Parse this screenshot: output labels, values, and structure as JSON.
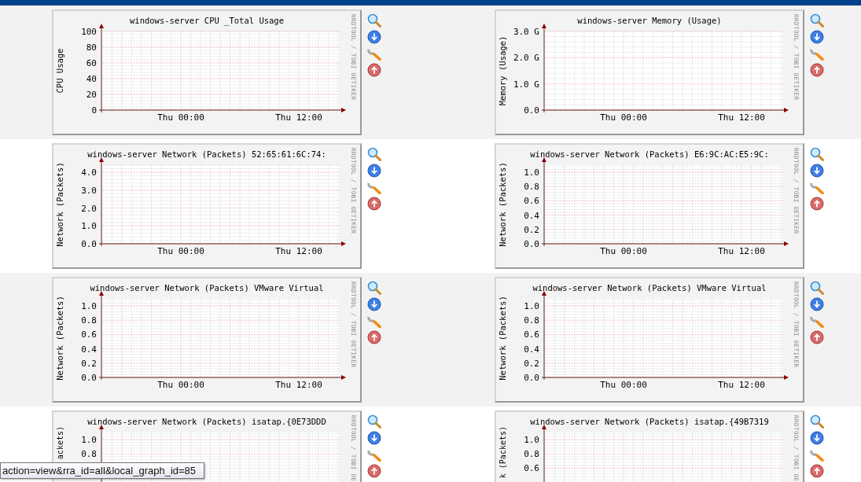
{
  "rows": [
    {
      "graphs": [
        {
          "title": "windows-server CPU _Total Usage",
          "credit": "RRDTOOL / TOBI OETIKER",
          "chart_data": {
            "type": "line",
            "grid": true,
            "ylabel": "CPU Usage",
            "categories": [
              null,
              null,
              null,
              null,
              null,
              null,
              null,
              null,
              "Thu 00:00",
              null,
              null,
              null,
              null,
              null,
              null,
              null,
              null,
              null,
              null,
              null,
              "Thu 12:00",
              null,
              null,
              null,
              null
            ],
            "ylim": [
              0,
              100
            ],
            "yticks": [
              {
                "value": 0,
                "label": "0"
              },
              {
                "value": 20,
                "label": "20"
              },
              {
                "value": 40,
                "label": "40"
              },
              {
                "value": 60,
                "label": "60"
              },
              {
                "value": 80,
                "label": "80"
              },
              {
                "value": 100,
                "label": "100"
              }
            ]
          }
        },
        {
          "title": "windows-server Memory (Usage)",
          "credit": "RRDTOOL / TOBI OETIKER",
          "chart_data": {
            "type": "line",
            "grid": true,
            "ylabel": "Memory (Usage)",
            "categories": [
              null,
              null,
              null,
              null,
              null,
              null,
              null,
              null,
              "Thu 00:00",
              null,
              null,
              null,
              null,
              null,
              null,
              null,
              null,
              null,
              null,
              null,
              "Thu 12:00",
              null,
              null,
              null,
              null
            ],
            "ylim": [
              0,
              3
            ],
            "yticks": [
              {
                "value": 0,
                "label": "0.0"
              },
              {
                "value": 1,
                "label": "1.0 G"
              },
              {
                "value": 2,
                "label": "2.0 G"
              },
              {
                "value": 3,
                "label": "3.0 G"
              }
            ]
          }
        }
      ]
    },
    {
      "graphs": [
        {
          "title": "windows-server Network (Packets) 52:65:61:6C:74:",
          "credit": "RRDTOOL / TOBI OETIKER",
          "chart_data": {
            "type": "line",
            "grid": true,
            "ylabel": "Network (Packets)",
            "categories": [
              null,
              null,
              null,
              null,
              null,
              null,
              null,
              null,
              "Thu 00:00",
              null,
              null,
              null,
              null,
              null,
              null,
              null,
              null,
              null,
              null,
              null,
              "Thu 12:00",
              null,
              null,
              null,
              null
            ],
            "ylim": [
              0,
              4.4
            ],
            "yticks": [
              {
                "value": 0,
                "label": "0.0"
              },
              {
                "value": 1,
                "label": "1.0"
              },
              {
                "value": 2,
                "label": "2.0"
              },
              {
                "value": 3,
                "label": "3.0"
              },
              {
                "value": 4,
                "label": "4.0"
              }
            ]
          }
        },
        {
          "title": "windows-server Network (Packets) E6:9C:AC:E5:9C:",
          "credit": "RRDTOOL / TOBI OETIKER",
          "chart_data": {
            "type": "line",
            "grid": true,
            "ylabel": "Network (Packets)",
            "categories": [
              null,
              null,
              null,
              null,
              null,
              null,
              null,
              null,
              "Thu 00:00",
              null,
              null,
              null,
              null,
              null,
              null,
              null,
              null,
              null,
              null,
              null,
              "Thu 12:00",
              null,
              null,
              null,
              null
            ],
            "ylim": [
              0,
              1.1
            ],
            "yticks": [
              {
                "value": 0,
                "label": "0.0"
              },
              {
                "value": 0.2,
                "label": "0.2"
              },
              {
                "value": 0.4,
                "label": "0.4"
              },
              {
                "value": 0.6,
                "label": "0.6"
              },
              {
                "value": 0.8,
                "label": "0.8"
              },
              {
                "value": 1,
                "label": "1.0"
              }
            ]
          }
        }
      ]
    },
    {
      "graphs": [
        {
          "title": "windows-server Network (Packets) VMware Virtual",
          "credit": "RRDTOOL / TOBI OETIKER",
          "chart_data": {
            "type": "line",
            "grid": true,
            "ylabel": "Network (Packets)",
            "categories": [
              null,
              null,
              null,
              null,
              null,
              null,
              null,
              null,
              "Thu 00:00",
              null,
              null,
              null,
              null,
              null,
              null,
              null,
              null,
              null,
              null,
              null,
              "Thu 12:00",
              null,
              null,
              null,
              null
            ],
            "ylim": [
              0,
              1.1
            ],
            "yticks": [
              {
                "value": 0,
                "label": "0.0"
              },
              {
                "value": 0.2,
                "label": "0.2"
              },
              {
                "value": 0.4,
                "label": "0.4"
              },
              {
                "value": 0.6,
                "label": "0.6"
              },
              {
                "value": 0.8,
                "label": "0.8"
              },
              {
                "value": 1,
                "label": "1.0"
              }
            ]
          }
        },
        {
          "title": "windows-server Network (Packets) VMware Virtual",
          "credit": "RRDTOOL / TOBI OETIKER",
          "chart_data": {
            "type": "line",
            "grid": true,
            "ylabel": "Network (Packets)",
            "categories": [
              null,
              null,
              null,
              null,
              null,
              null,
              null,
              null,
              "Thu 00:00",
              null,
              null,
              null,
              null,
              null,
              null,
              null,
              null,
              null,
              null,
              null,
              "Thu 12:00",
              null,
              null,
              null,
              null
            ],
            "ylim": [
              0,
              1.1
            ],
            "yticks": [
              {
                "value": 0,
                "label": "0.0"
              },
              {
                "value": 0.2,
                "label": "0.2"
              },
              {
                "value": 0.4,
                "label": "0.4"
              },
              {
                "value": 0.6,
                "label": "0.6"
              },
              {
                "value": 0.8,
                "label": "0.8"
              },
              {
                "value": 1,
                "label": "1.0"
              }
            ]
          }
        }
      ]
    },
    {
      "graphs": [
        {
          "title": "windows-server Network (Packets) isatap.{0E73DDD",
          "credit": "RRDTOOL / TOBI OE",
          "ylabel_clipped": true,
          "chart_data": {
            "type": "line",
            "grid": true,
            "ylabel": "ackets)",
            "categories": [
              null,
              null,
              null,
              null,
              null,
              null,
              null,
              null,
              null,
              null,
              null,
              null,
              null,
              null,
              null,
              null,
              null,
              null,
              null,
              null,
              null,
              null,
              null,
              null,
              null
            ],
            "ylim": [
              0,
              1.1
            ],
            "yticks": [
              {
                "value": 0.8,
                "label": "0.8"
              },
              {
                "value": 1,
                "label": "1.0"
              }
            ]
          }
        },
        {
          "title": "windows-server Network (Packets) isatap.{49B7319",
          "credit": "RRDTOOL / TOBI OE",
          "ylabel_clipped": true,
          "chart_data": {
            "type": "line",
            "grid": true,
            "ylabel": "k (Packets)",
            "categories": [
              null,
              null,
              null,
              null,
              null,
              null,
              null,
              null,
              null,
              null,
              null,
              null,
              null,
              null,
              null,
              null,
              null,
              null,
              null,
              null,
              null,
              null,
              null,
              null,
              null
            ],
            "ylim": [
              0,
              1.1
            ],
            "yticks": [
              {
                "value": 0.6,
                "label": "0.6"
              },
              {
                "value": 0.8,
                "label": "0.8"
              },
              {
                "value": 1,
                "label": "1.0"
              }
            ]
          }
        }
      ]
    }
  ],
  "status_tooltip": "action=view&rra_id=all&local_graph_id=85"
}
